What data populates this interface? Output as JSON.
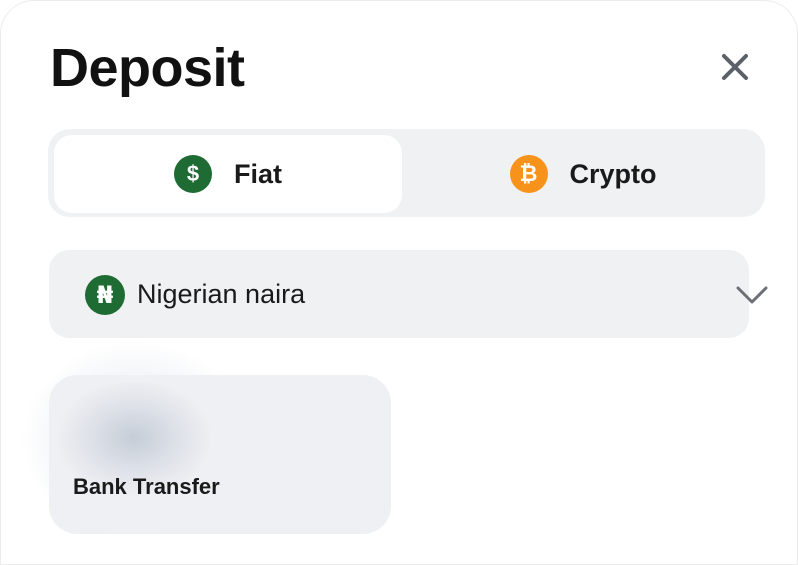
{
  "header": {
    "title": "Deposit",
    "close_icon": "close-icon"
  },
  "tabs": [
    {
      "label": "Fiat",
      "icon": "dollar-icon",
      "icon_glyph": "$",
      "icon_color": "#1e6b34",
      "selected": true
    },
    {
      "label": "Crypto",
      "icon": "bitcoin-icon",
      "icon_glyph": "₿",
      "icon_color": "#f7931a",
      "selected": false
    }
  ],
  "currency_select": {
    "selected": "Nigerian naira",
    "icon": "naira-icon",
    "icon_glyph": "₦",
    "icon_color": "#1e6b34",
    "chevron": "chevron-down-icon"
  },
  "payment_methods": [
    {
      "label": "Bank Transfer"
    }
  ],
  "colors": {
    "accent_fiat": "#1e6b34",
    "accent_crypto": "#f7931a",
    "panel_bg": "#f0f1f3"
  }
}
